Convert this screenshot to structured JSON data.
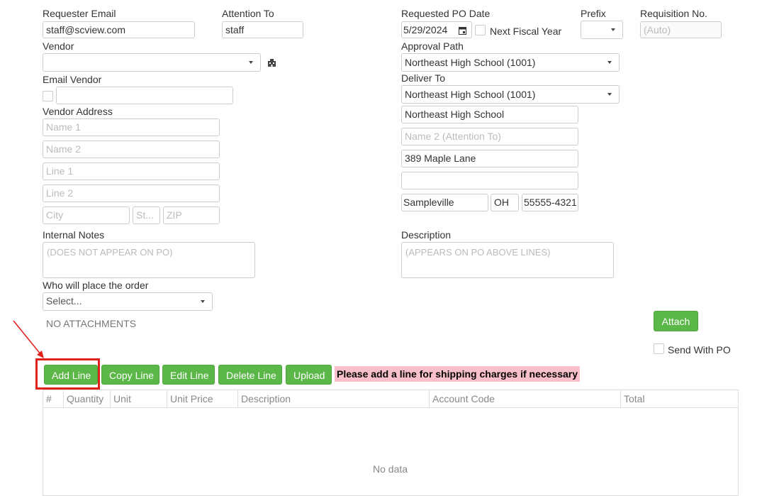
{
  "form": {
    "requester_email": {
      "label": "Requester Email",
      "value": "staff@scview.com"
    },
    "attention_to": {
      "label": "Attention To",
      "value": "staff"
    },
    "requested_po_date": {
      "label": "Requested PO Date",
      "value": "5/29/2024"
    },
    "next_fiscal_year": {
      "label": "Next Fiscal Year"
    },
    "prefix": {
      "label": "Prefix",
      "value": ""
    },
    "requisition_no": {
      "label": "Requisition No.",
      "placeholder": "(Auto)"
    },
    "vendor": {
      "label": "Vendor",
      "value": ""
    },
    "email_vendor": {
      "label": "Email Vendor",
      "value": ""
    },
    "vendor_address": {
      "label": "Vendor Address",
      "name1_placeholder": "Name 1",
      "name2_placeholder": "Name 2",
      "line1_placeholder": "Line 1",
      "line2_placeholder": "Line 2",
      "city_placeholder": "City",
      "state_placeholder": "St...",
      "zip_placeholder": "ZIP"
    },
    "approval_path": {
      "label": "Approval Path",
      "value": "Northeast High School (1001)"
    },
    "deliver_to": {
      "label": "Deliver To",
      "value": "Northeast High School (1001)",
      "name1": "Northeast High School",
      "name2_placeholder": "Name 2 (Attention To)",
      "line1": "389 Maple Lane",
      "line2": "",
      "city": "Sampleville",
      "state": "OH",
      "zip": "55555-4321"
    },
    "internal_notes": {
      "label": "Internal Notes",
      "placeholder": "(DOES NOT APPEAR ON PO)"
    },
    "description": {
      "label": "Description",
      "placeholder": "(APPEARS ON PO ABOVE LINES)"
    },
    "who_places_order": {
      "label": "Who will place the order",
      "placeholder": "Select..."
    },
    "attachments_text": "NO ATTACHMENTS",
    "attach_label": "Attach",
    "send_with_po_label": "Send With PO"
  },
  "toolbar": {
    "add_line": "Add Line",
    "copy_line": "Copy Line",
    "edit_line": "Edit Line",
    "delete_line": "Delete Line",
    "upload": "Upload",
    "notice": "Please add a line for shipping charges if necessary"
  },
  "grid": {
    "columns": [
      "#",
      "Quantity",
      "Unit",
      "Unit Price",
      "Description",
      "Account Code",
      "Total"
    ],
    "empty_text": "No data"
  },
  "colors": {
    "button_green": "#5cb749",
    "notice_bg": "#f9c0cb",
    "highlight_red": "#e0201b"
  },
  "icons": {
    "vendor_lookup": "building-icon",
    "calendar": "calendar-icon"
  }
}
